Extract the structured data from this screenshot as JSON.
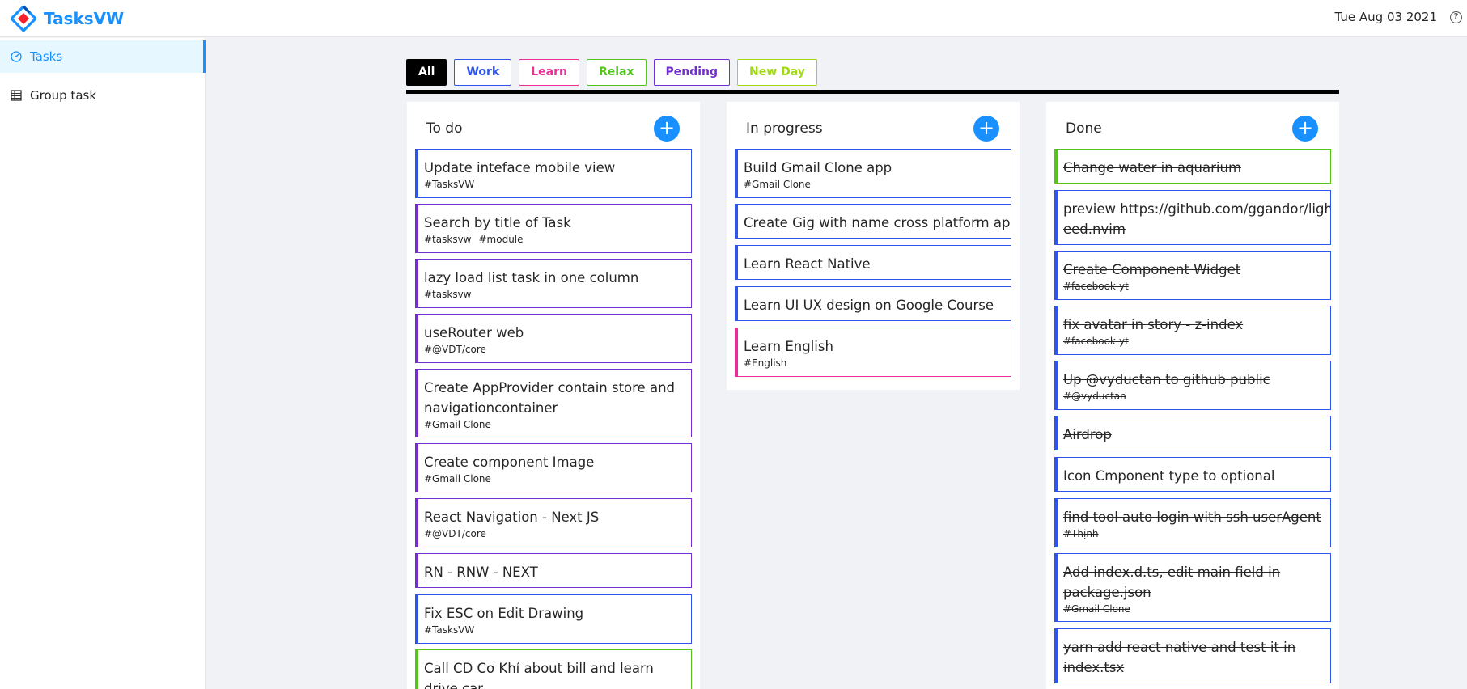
{
  "app": {
    "name": "TasksVW",
    "date": "Tue Aug 03 2021",
    "help_icon": "?"
  },
  "sidebar": {
    "items": [
      {
        "label": "Tasks",
        "icon": "dashboard-icon",
        "active": true
      },
      {
        "label": "Group task",
        "icon": "table-icon",
        "active": false
      }
    ]
  },
  "filters": [
    {
      "label": "All",
      "color": "#000000",
      "active": true
    },
    {
      "label": "Work",
      "color": "#2f54eb",
      "active": false
    },
    {
      "label": "Learn",
      "color": "#eb2f96",
      "active": false
    },
    {
      "label": "Relax",
      "color": "#52c41a",
      "active": false
    },
    {
      "label": "Pending",
      "color": "#722ed1",
      "active": false
    },
    {
      "label": "New Day",
      "color": "#a0d911",
      "active": false
    }
  ],
  "columns": [
    {
      "title": "To do",
      "cards": [
        {
          "title": "Update inteface mobile view",
          "tags": [
            "#TasksVW"
          ],
          "color": "#2f54eb"
        },
        {
          "title": "Search by title of Task",
          "tags": [
            "#tasksvw",
            "#module"
          ],
          "color": "#722ed1"
        },
        {
          "title": "lazy load list task in one column",
          "tags": [
            "#tasksvw"
          ],
          "color": "#722ed1"
        },
        {
          "title": "useRouter web",
          "tags": [
            "#@VDT/core"
          ],
          "color": "#722ed1"
        },
        {
          "title": "Create AppProvider contain store and navigationcontainer",
          "tags": [
            "#Gmail Clone"
          ],
          "color": "#722ed1"
        },
        {
          "title": "Create component Image",
          "tags": [
            "#Gmail Clone"
          ],
          "color": "#722ed1"
        },
        {
          "title": "React Navigation - Next JS",
          "tags": [
            "#@VDT/core"
          ],
          "color": "#722ed1"
        },
        {
          "title": "RN - RNW - NEXT",
          "tags": [],
          "color": "#722ed1"
        },
        {
          "title": "Fix ESC on Edit Drawing",
          "tags": [
            "#TasksVW"
          ],
          "color": "#2f54eb"
        },
        {
          "title": "Call CD Cơ Khí about bill and learn drive car",
          "tags": [],
          "color": "#52c41a"
        }
      ]
    },
    {
      "title": "In progress",
      "cards": [
        {
          "title": "Build Gmail Clone app",
          "tags": [
            "#Gmail Clone"
          ],
          "color": "#2f54eb"
        },
        {
          "title": "Create Gig with name cross platform app",
          "tags": [],
          "color": "#2f54eb"
        },
        {
          "title": "Learn React Native",
          "tags": [],
          "color": "#2f54eb"
        },
        {
          "title": "Learn UI UX design on Google Course",
          "tags": [],
          "color": "#2f54eb"
        },
        {
          "title": "Learn English",
          "tags": [
            "#English"
          ],
          "color": "#eb2f96"
        }
      ]
    },
    {
      "title": "Done",
      "cards": [
        {
          "title": "Change water in aquarium",
          "tags": [],
          "color": "#52c41a"
        },
        {
          "title": "preview https://github.com/ggandor/lightspeed.nvim",
          "tags": [],
          "color": "#2f54eb"
        },
        {
          "title": "Create Component Widget",
          "tags": [
            "#facebook-yt"
          ],
          "color": "#2f54eb"
        },
        {
          "title": "fix avatar in story - z-index",
          "tags": [
            "#facebook-yt"
          ],
          "color": "#2f54eb"
        },
        {
          "title": "Up @vyductan to github public",
          "tags": [
            "#@vyductan"
          ],
          "color": "#2f54eb"
        },
        {
          "title": "Airdrop",
          "tags": [],
          "color": "#2f54eb"
        },
        {
          "title": "Icon Cmponent type to optional",
          "tags": [],
          "color": "#2f54eb"
        },
        {
          "title": "find tool auto login with ssh userAgent",
          "tags": [
            "#Thịnh"
          ],
          "color": "#2f54eb"
        },
        {
          "title": "Add index.d.ts, edit main field in package.json",
          "tags": [
            "#Gmail Clone"
          ],
          "color": "#2f54eb"
        },
        {
          "title": "yarn add react native and test it in index.tsx",
          "tags": [],
          "color": "#2f54eb"
        }
      ]
    }
  ],
  "add_button_label": "+"
}
